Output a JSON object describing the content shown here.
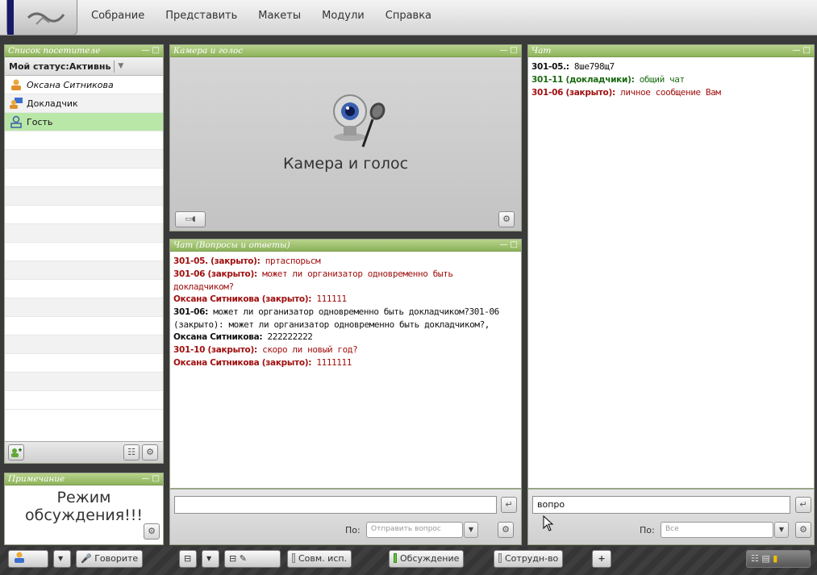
{
  "menu": {
    "items": [
      "Собрание",
      "Представить",
      "Макеты",
      "Модули",
      "Справка"
    ]
  },
  "visitors": {
    "title": "Список посетителе",
    "window_buttons": "— □",
    "status_label": "Мой статус:Активнь",
    "users": [
      {
        "name": "Оксана Ситникова",
        "icon": "host-icon"
      },
      {
        "name": "Докладчик",
        "icon": "presenter-icon"
      },
      {
        "name": "Гость",
        "icon": "guest-icon"
      }
    ]
  },
  "note": {
    "title": "Примечание",
    "window_buttons": "— □",
    "text_line1": "Режим",
    "text_line2": "обсуждения!!!"
  },
  "camera": {
    "title": "Камера и голос",
    "window_buttons": "— □",
    "caption": "Камера и голос"
  },
  "qa": {
    "title": "Чат (Вопросы и ответы)",
    "window_buttons": "— □",
    "lines": [
      {
        "who": "301-05. (закрыто):",
        "msg": " пртаспорьсм",
        "color": "red"
      },
      {
        "who": "301-06 (закрыто):",
        "msg": " может ли организатор одновременно быть докладчиком?",
        "color": "red"
      },
      {
        "who": "Оксана Ситникова (закрыто):",
        "msg": " 111111",
        "color": "red"
      },
      {
        "who": "301-06:",
        "msg": " может ли организатор одновременно быть докладчиком?301-06 (закрыто): может ли организатор одновременно быть докладчиком?,",
        "color": "black"
      },
      {
        "who": "Оксана Ситникова:",
        "msg": " 222222222",
        "color": "black"
      },
      {
        "who": "301-10 (закрыто):",
        "msg": " скоро ли новый год?",
        "color": "red"
      },
      {
        "who": "Оксана Ситникова (закрыто):",
        "msg": " 1111111",
        "color": "red"
      }
    ],
    "input_value": "",
    "to_label": "По:",
    "combo_value": "Отправить вопрос"
  },
  "chat": {
    "title": "Чат",
    "window_buttons": "— □",
    "lines": [
      {
        "who": "301-05.:",
        "msg": " 8ше798щ7",
        "color": "black"
      },
      {
        "who": "301-11 (докладчики):",
        "msg": " общий чат",
        "color": "green"
      },
      {
        "who": "301-06 (закрыто):",
        "msg": " личное сообщение Вам",
        "color": "red"
      }
    ],
    "input_value": "вопро",
    "to_label": "По:",
    "combo_value": "Все"
  },
  "bottombar": {
    "talk_label": "Говорите",
    "sharing_label": "Совм. исп.",
    "discussion_label": "Обсуждение",
    "collab_label": "Сотрудн-во",
    "add_label": "+"
  },
  "colors": {
    "panel_title": "#8db35a",
    "selected_row": "#b9e7a8",
    "closed_msg": "#a01010",
    "presenter_msg": "#1a6b12"
  }
}
